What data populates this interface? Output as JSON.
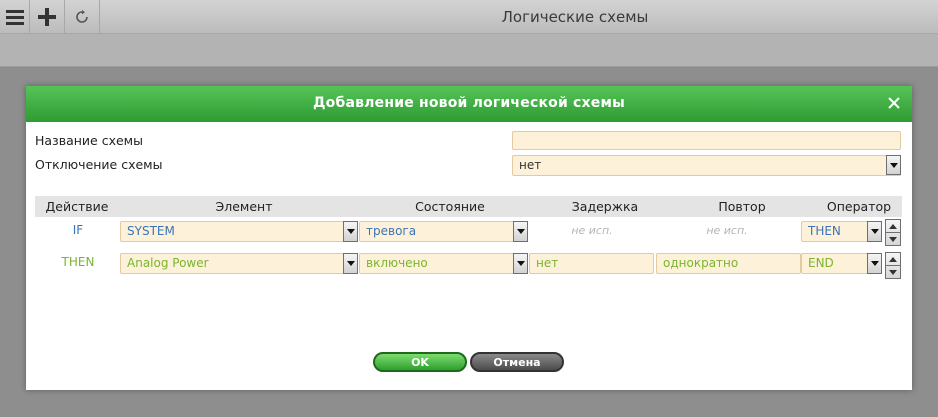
{
  "app": {
    "title": "Логические схемы"
  },
  "toolbar": {
    "icons": [
      "menu-icon",
      "plus-icon",
      "refresh-icon"
    ]
  },
  "modal": {
    "title": "Добавление новой логической схемы",
    "close_symbol": "✕",
    "fields": {
      "name_label": "Название схемы",
      "name_value": "",
      "disable_label": "Отключение схемы",
      "disable_value": "нет"
    },
    "table": {
      "headers": [
        "Действие",
        "Элемент",
        "Состояние",
        "Задержка",
        "Повтор",
        "Оператор"
      ],
      "rows": [
        {
          "action": "IF",
          "element": "SYSTEM",
          "state": "тревога",
          "delay": "не исп.",
          "repeat": "не исп.",
          "operator": "THEN"
        },
        {
          "action": "THEN",
          "element": "Analog Power",
          "state": "включено",
          "delay": "нет",
          "repeat": "однократно",
          "operator": "END"
        }
      ]
    },
    "buttons": {
      "ok": "OK",
      "cancel": "Отмена"
    }
  },
  "colors": {
    "header_green": "#3fae43",
    "if_text": "#3b73b9",
    "then_text": "#7ab52d",
    "field_bg": "#fdf2d9"
  }
}
